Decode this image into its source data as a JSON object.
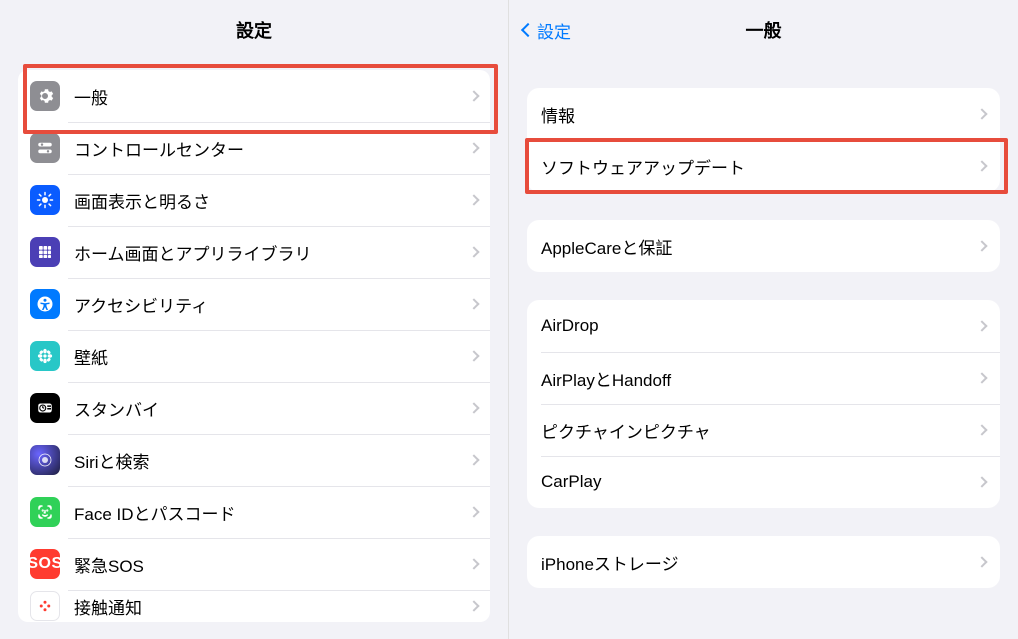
{
  "left": {
    "title": "設定",
    "items": [
      {
        "label": "一般"
      },
      {
        "label": "コントロールセンター"
      },
      {
        "label": "画面表示と明るさ"
      },
      {
        "label": "ホーム画面とアプリライブラリ"
      },
      {
        "label": "アクセシビリティ"
      },
      {
        "label": "壁紙"
      },
      {
        "label": "スタンバイ"
      },
      {
        "label": "Siriと検索"
      },
      {
        "label": "Face IDとパスコード"
      },
      {
        "label": "緊急SOS"
      },
      {
        "label": "接触通知"
      }
    ],
    "sos_text": "SOS"
  },
  "right": {
    "back_label": "設定",
    "title": "一般",
    "group1": [
      {
        "label": "情報"
      },
      {
        "label": "ソフトウェアアップデート"
      }
    ],
    "group2": [
      {
        "label": "AppleCareと保証"
      }
    ],
    "group3": [
      {
        "label": "AirDrop"
      },
      {
        "label": "AirPlayとHandoff"
      },
      {
        "label": "ピクチャインピクチャ"
      },
      {
        "label": "CarPlay"
      }
    ],
    "group4": [
      {
        "label": "iPhoneストレージ"
      }
    ]
  }
}
